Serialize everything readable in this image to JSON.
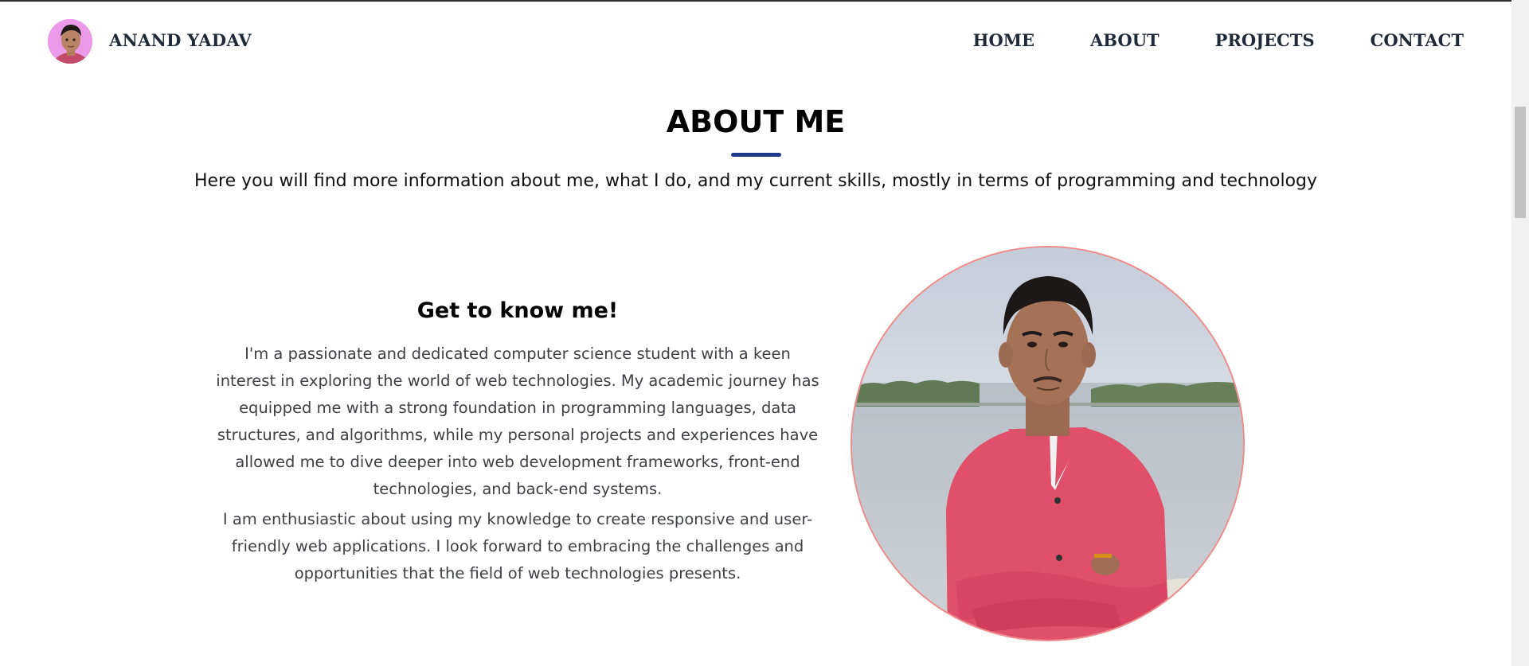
{
  "navbar": {
    "name": "ANAND YADAV",
    "links": [
      {
        "label": "HOME"
      },
      {
        "label": "ABOUT"
      },
      {
        "label": "PROJECTS"
      },
      {
        "label": "CONTACT"
      }
    ]
  },
  "about": {
    "title": "ABOUT ME",
    "subtitle": "Here you will find more information about me, what I do, and my current skills, mostly in terms of programming and technology",
    "know_title": "Get to know me!",
    "paragraphs": [
      "I'm a passionate and dedicated computer science student with a keen interest in exploring the world of web technologies. My academic journey has equipped me with a strong foundation in programming languages, data structures, and algorithms, while my personal projects and experiences have allowed me to dive deeper into web development frameworks, front-end technologies, and back-end systems.",
      "I am enthusiastic about using my knowledge to create responsive and user-friendly web applications. I look forward to embracing the challenges and opportunities that the field of web technologies presents."
    ]
  },
  "colors": {
    "accent_underline": "#1e3a8a",
    "avatar_bg": "#ea9ae8",
    "portrait_border": "#f08a8a",
    "shirt": "#e0506a"
  },
  "icons": {
    "nav_avatar": "profile-photo",
    "portrait": "profile-portrait-photo"
  }
}
